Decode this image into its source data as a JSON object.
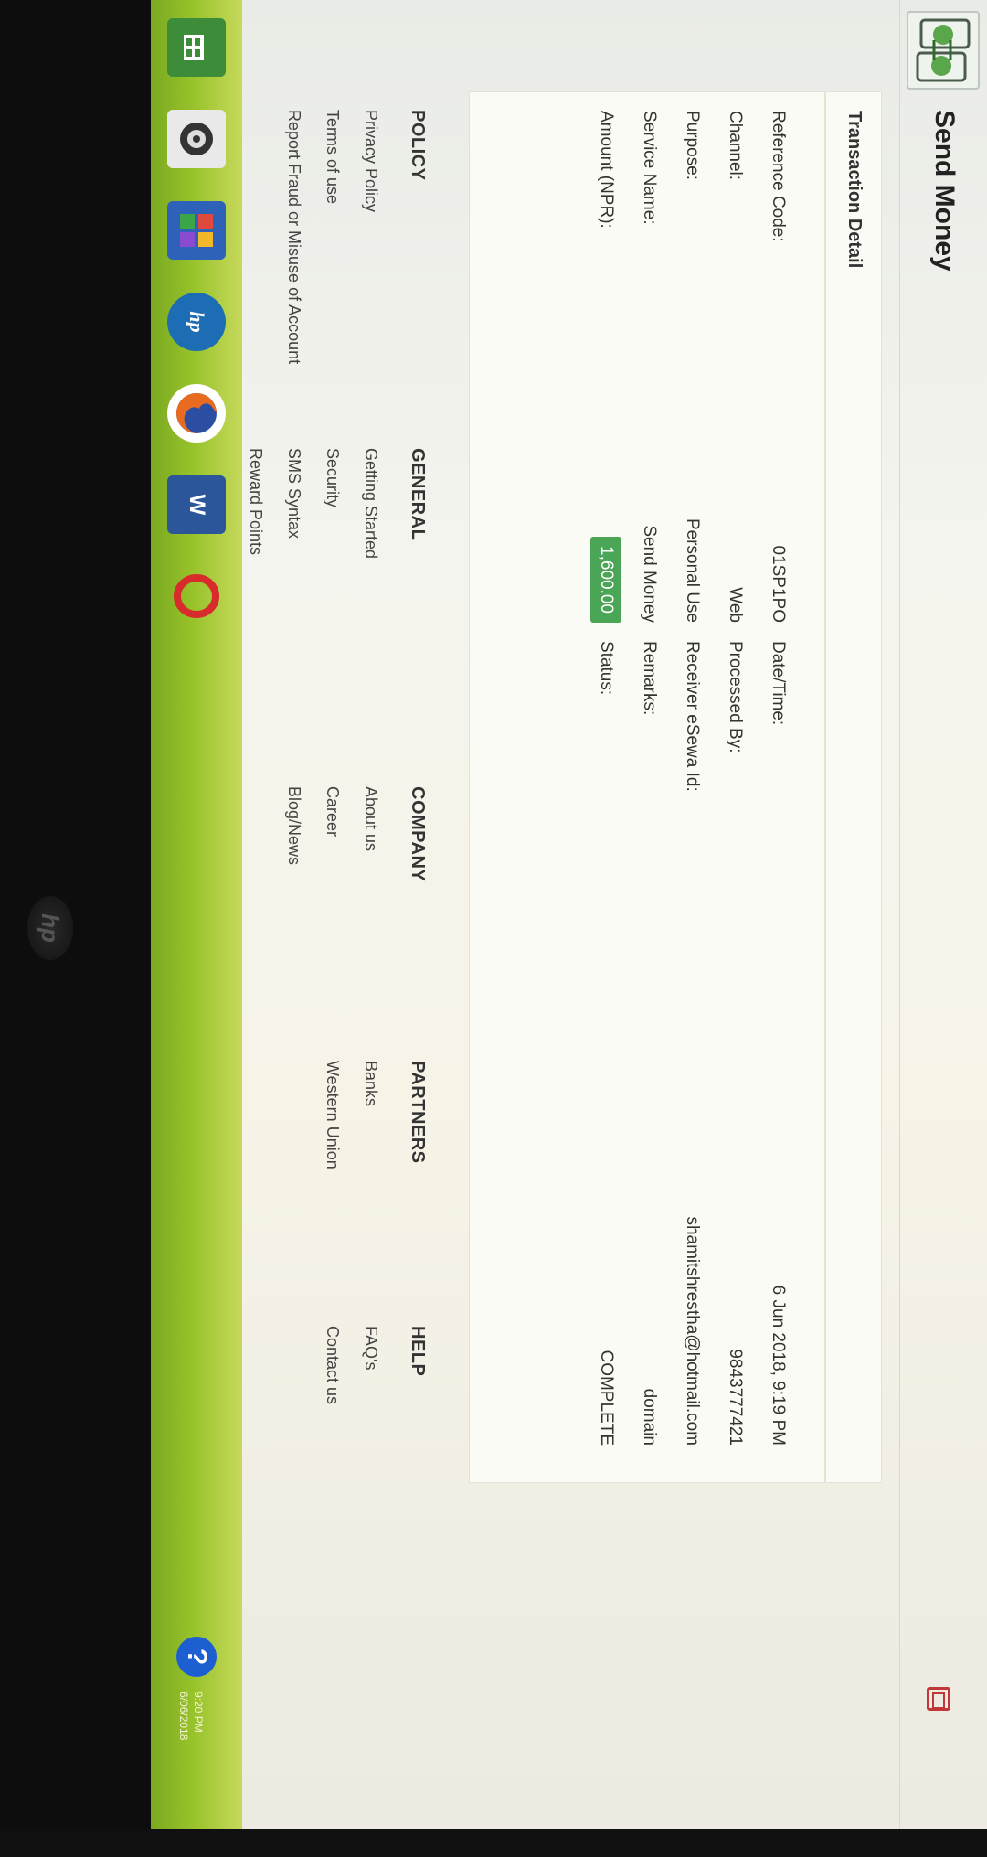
{
  "header": {
    "title": "Send Money"
  },
  "transaction": {
    "section_title": "Transaction Detail",
    "rows": [
      {
        "label": "Reference Code:",
        "value": "01SP1PO",
        "label2": "Date/Time:",
        "value2": "6 Jun 2018, 9:19 PM"
      },
      {
        "label": "Channel:",
        "value": "Web",
        "label2": "Processed By:",
        "value2": "9843777421"
      },
      {
        "label": "Purpose:",
        "value": "Personal Use",
        "label2": "Receiver eSewa Id:",
        "value2": "shamitshrestha@hotmail.com"
      },
      {
        "label": "Service Name:",
        "value": "Send Money",
        "label2": "Remarks:",
        "value2": "domain"
      },
      {
        "label": "Amount (NPR):",
        "value": "1,600.00",
        "label2": "Status:",
        "value2": "COMPLETE"
      }
    ]
  },
  "footer": {
    "columns": [
      {
        "heading": "POLICY",
        "links": [
          "Privacy Policy",
          "Terms of use",
          "Report Fraud or Misuse of Account"
        ]
      },
      {
        "heading": "GENERAL",
        "links": [
          "Getting Started",
          "Security",
          "SMS Syntax",
          "Reward Points"
        ]
      },
      {
        "heading": "COMPANY",
        "links": [
          "About us",
          "Career",
          "Blog/News"
        ]
      },
      {
        "heading": "PARTNERS",
        "links": [
          "Banks",
          "Western Union"
        ]
      },
      {
        "heading": "HELP",
        "links": [
          "FAQ's",
          "Contact us"
        ]
      }
    ]
  },
  "taskbar": {
    "apps": [
      "store-icon",
      "media-player-icon",
      "photos-icon",
      "hp-icon",
      "firefox-icon",
      "word-icon",
      "opera-icon"
    ],
    "clock_time": "9:20 PM",
    "clock_date": "6/06/2018",
    "help_glyph": "?"
  },
  "colors": {
    "amount_green": "#4aa556",
    "taskbar_green": "#97c22a",
    "call_green": "#2f8f3a"
  }
}
